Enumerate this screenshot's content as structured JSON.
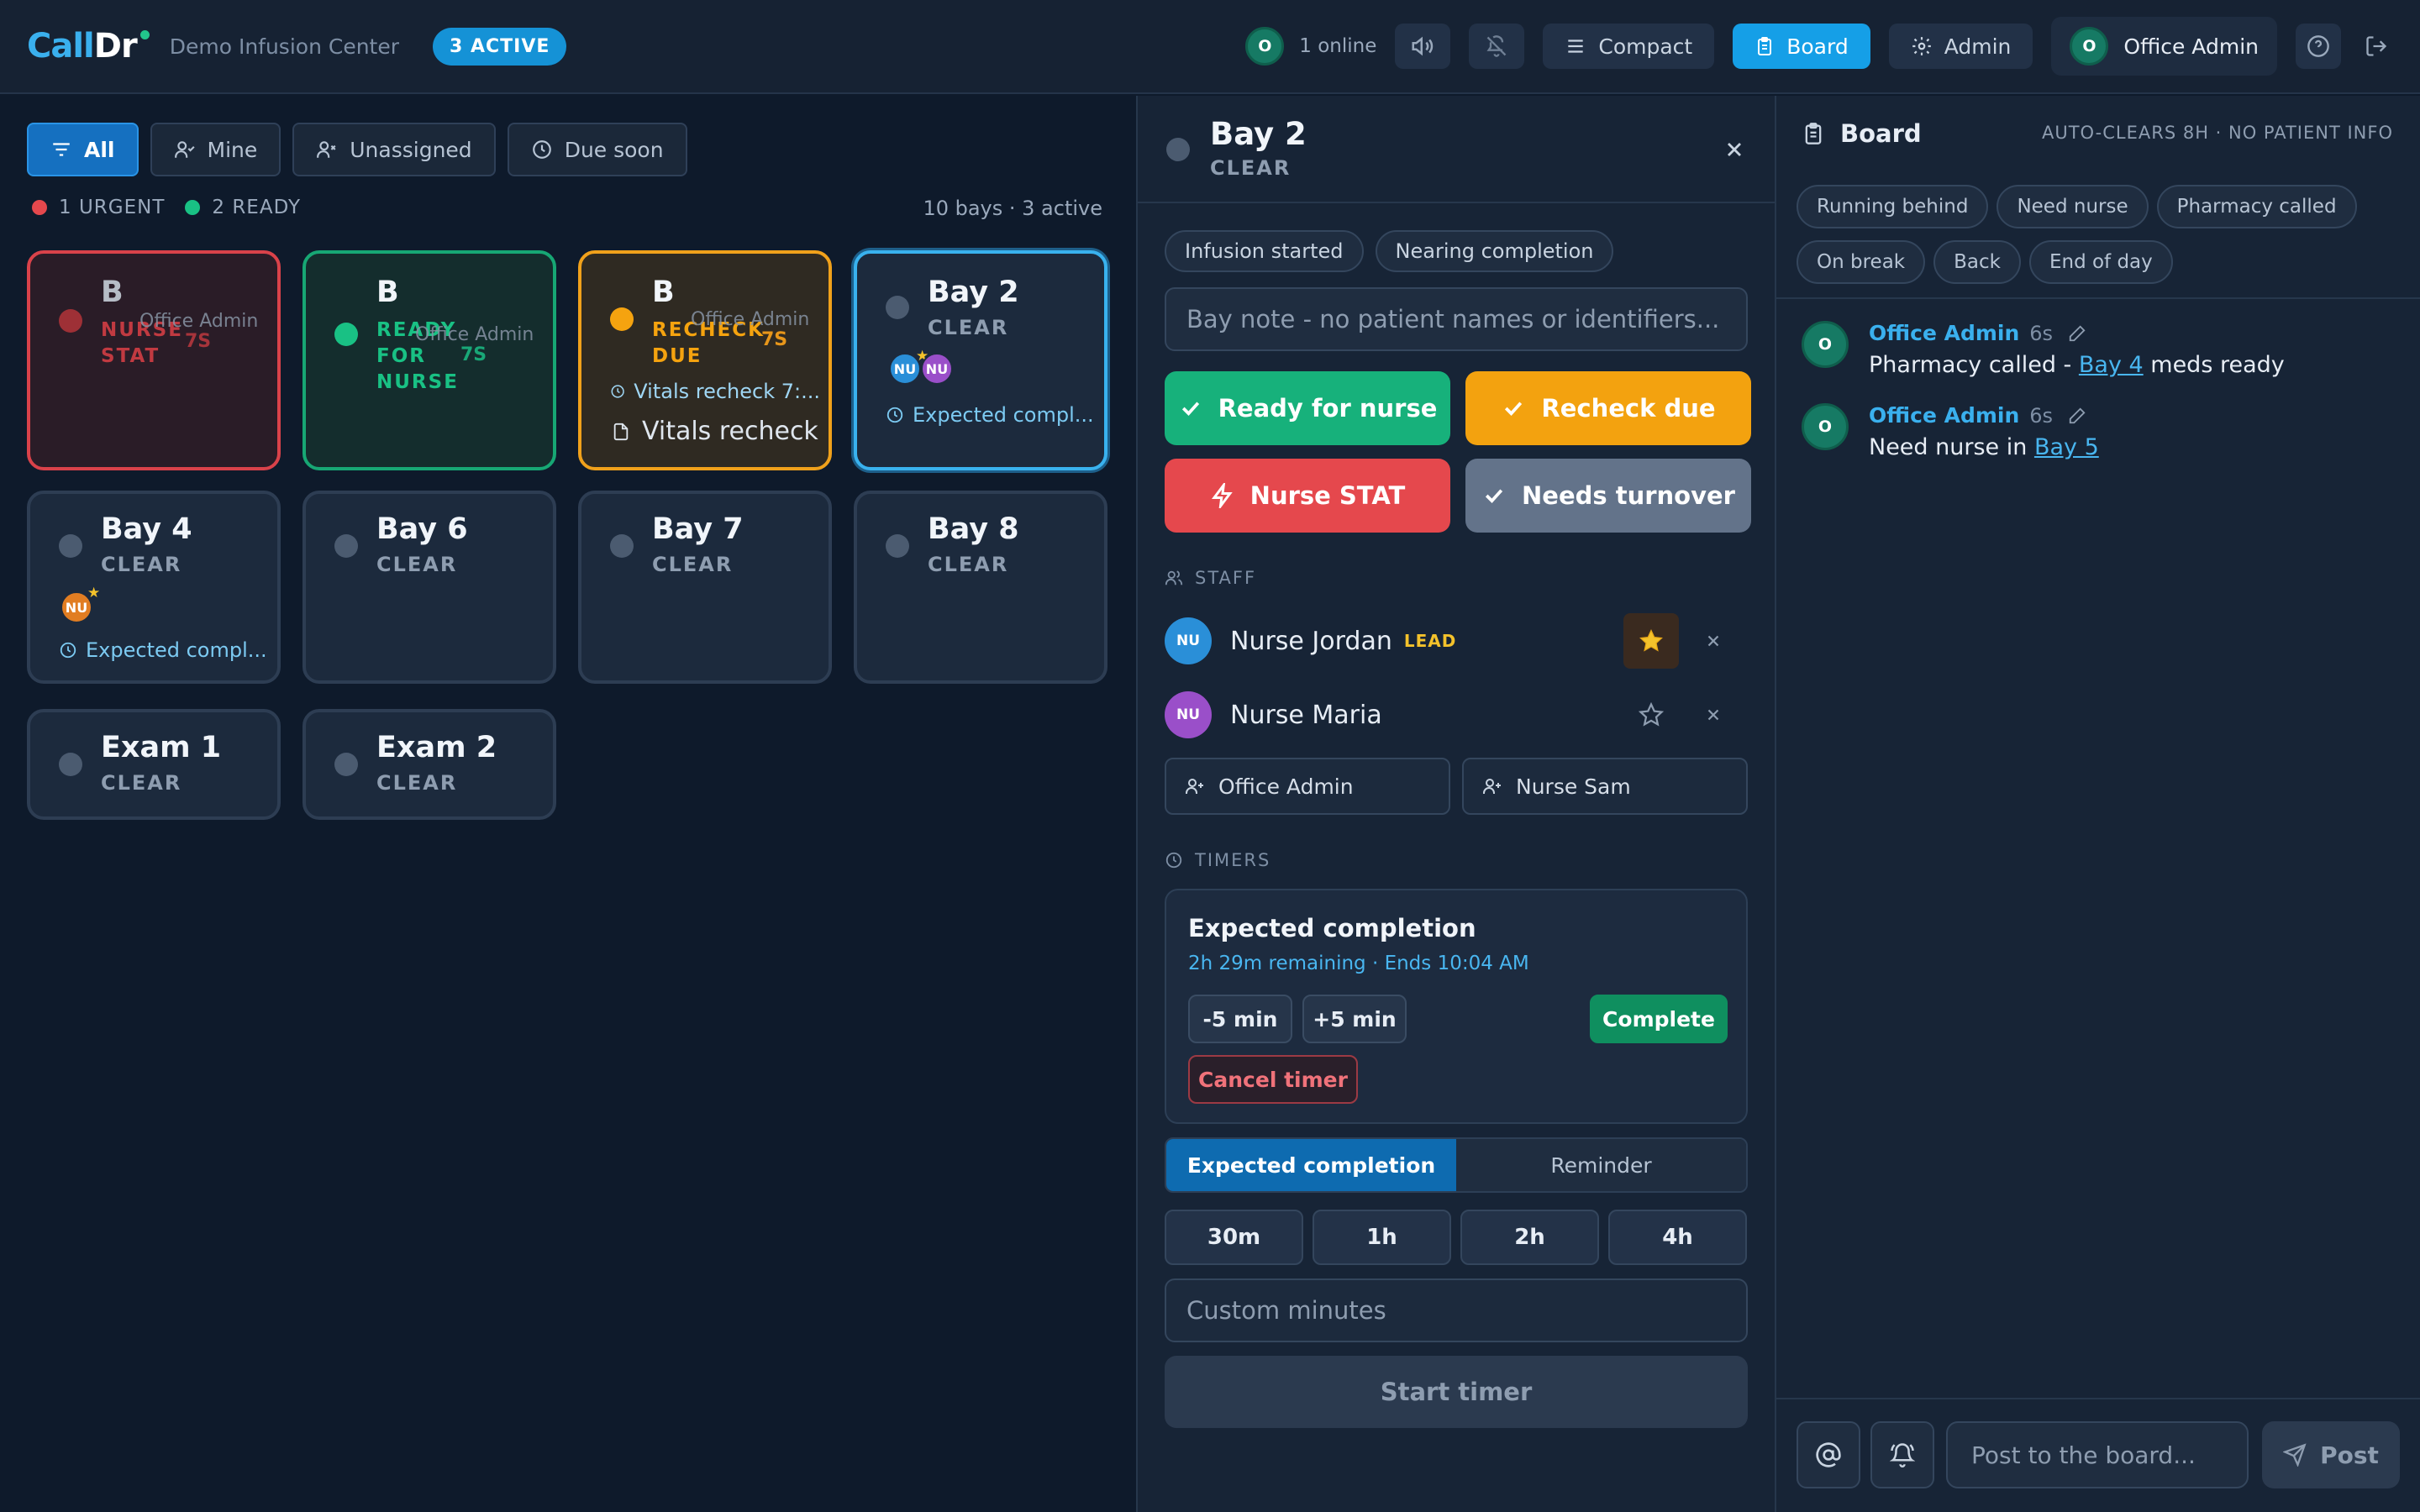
{
  "app": {
    "logo_a": "Call",
    "logo_b": "Dr",
    "org": "Demo Infusion Center",
    "active_pill": "3 ACTIVE"
  },
  "topbar": {
    "online_avatar": "O",
    "online": "1 online",
    "compact": "Compact",
    "board": "Board",
    "admin": "Admin",
    "user_initial": "O",
    "user": "Office Admin"
  },
  "filters": {
    "all": "All",
    "mine": "Mine",
    "unassigned": "Unassigned",
    "due_soon": "Due soon"
  },
  "summary": {
    "urgent": "1 URGENT",
    "ready": "2 READY",
    "count": "10 bays · 3 active"
  },
  "bays": [
    {
      "name": "B",
      "status": "NURSE STAT",
      "assignee": "Office Admin",
      "elapsed": "7S",
      "color": "#e5484d"
    },
    {
      "name": "B",
      "status": "READY FOR NURSE",
      "assignee": "Office Admin",
      "elapsed": "7S",
      "color": "#19c184"
    },
    {
      "name": "B",
      "status": "RECHECK DUE",
      "assignee": "Office Admin",
      "elapsed": "7S",
      "timer": "Vitals recheck 7:...",
      "note": "Vitals recheck",
      "color": "#f5a30f"
    },
    {
      "name": "Bay 2",
      "status": "CLEAR",
      "avatar1": "NU",
      "avatar2": "NU",
      "timer": "Expected compl..."
    },
    {
      "name": "Bay 4",
      "status": "CLEAR",
      "avatar1": "NU",
      "timer": "Expected compl..."
    },
    {
      "name": "Bay 6",
      "status": "CLEAR"
    },
    {
      "name": "Bay 7",
      "status": "CLEAR"
    },
    {
      "name": "Bay 8",
      "status": "CLEAR"
    },
    {
      "name": "Exam 1",
      "status": "CLEAR"
    },
    {
      "name": "Exam 2",
      "status": "CLEAR"
    }
  ],
  "detail": {
    "title": "Bay 2",
    "status": "CLEAR",
    "chips": [
      "Infusion started",
      "Nearing completion"
    ],
    "note_placeholder": "Bay note - no patient names or identifiers...",
    "actions": {
      "ready": "Ready for nurse",
      "recheck": "Recheck due",
      "stat": "Nurse STAT",
      "turnover": "Needs turnover"
    },
    "staff_label": "STAFF",
    "staff": [
      {
        "initials": "NU",
        "name": "Nurse Jordan",
        "badge": "LEAD"
      },
      {
        "initials": "NU",
        "name": "Nurse Maria"
      }
    ],
    "assign": [
      "Office Admin",
      "Nurse Sam"
    ],
    "timers_label": "TIMERS",
    "timer": {
      "title": "Expected completion",
      "sub": "2h 29m remaining · Ends 10:04 AM",
      "minus": "-5 min",
      "plus": "+5 min",
      "complete": "Complete",
      "cancel": "Cancel timer"
    },
    "tabs": {
      "a": "Expected completion",
      "b": "Reminder"
    },
    "durations": [
      "30m",
      "1h",
      "2h",
      "4h"
    ],
    "custom_placeholder": "Custom minutes",
    "start": "Start timer"
  },
  "board": {
    "title": "Board",
    "autoclear": "AUTO-CLEARS 8H · NO PATIENT INFO",
    "quick": [
      "Running behind",
      "Need nurse",
      "Pharmacy called",
      "On break",
      "Back",
      "End of day"
    ],
    "messages": [
      {
        "initial": "O",
        "author": "Office Admin",
        "time": "6s",
        "pre": "Pharmacy called - ",
        "link": "Bay 4",
        "post": " meds ready"
      },
      {
        "initial": "O",
        "author": "Office Admin",
        "time": "6s",
        "pre": "Need nurse in ",
        "link": "Bay 5",
        "post": ""
      }
    ],
    "compose_placeholder": "Post to the board...",
    "post": "Post"
  }
}
